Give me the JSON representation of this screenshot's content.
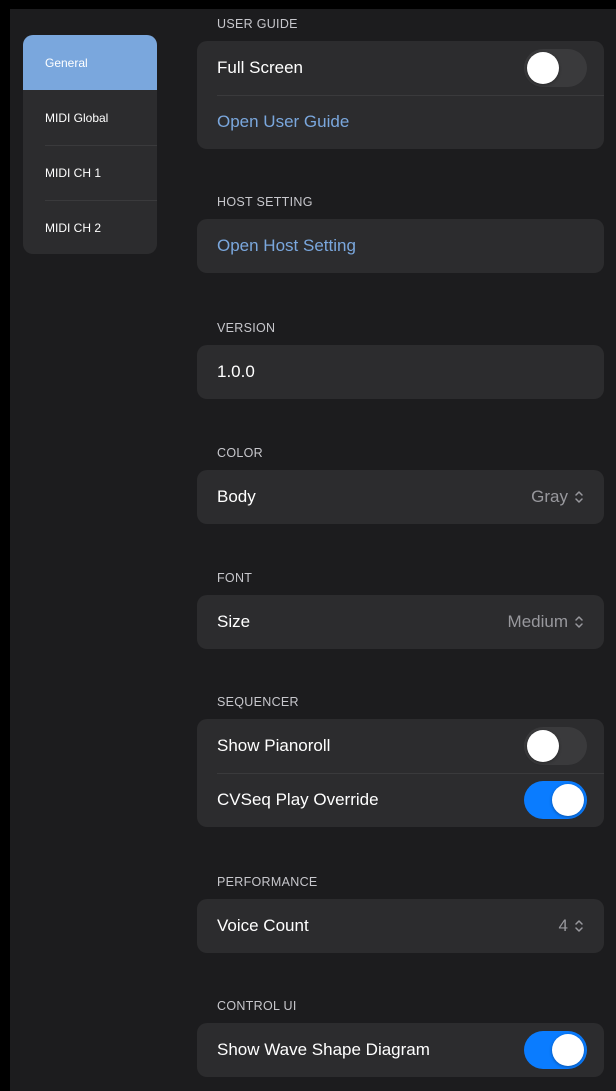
{
  "sidebar": {
    "items": [
      {
        "label": "General",
        "active": true
      },
      {
        "label": "MIDI Global",
        "active": false
      },
      {
        "label": "MIDI CH 1",
        "active": false
      },
      {
        "label": "MIDI CH 2",
        "active": false
      }
    ]
  },
  "sections": {
    "user_guide": {
      "header": "USER GUIDE",
      "full_screen_label": "Full Screen",
      "full_screen_on": false,
      "open_guide_label": "Open User Guide"
    },
    "host_setting": {
      "header": "HOST SETTING",
      "open_host_label": "Open Host Setting"
    },
    "version": {
      "header": "VERSION",
      "value": "1.0.0"
    },
    "color": {
      "header": "COLOR",
      "body_label": "Body",
      "body_value": "Gray"
    },
    "font": {
      "header": "FONT",
      "size_label": "Size",
      "size_value": "Medium"
    },
    "sequencer": {
      "header": "SEQUENCER",
      "pianoroll_label": "Show Pianoroll",
      "pianoroll_on": false,
      "cvseq_label": "CVSeq Play Override",
      "cvseq_on": true
    },
    "performance": {
      "header": "PERFORMANCE",
      "voice_label": "Voice Count",
      "voice_value": "4"
    },
    "control_ui": {
      "header": "CONTROL UI",
      "wave_label": "Show Wave Shape Diagram",
      "wave_on": true
    }
  },
  "colors": {
    "background": "#1c1c1e",
    "panel": "#2c2c2e",
    "accent_link": "#7aa7dd",
    "toggle_on": "#0a7cff",
    "toggle_off": "#3a3a3c"
  }
}
